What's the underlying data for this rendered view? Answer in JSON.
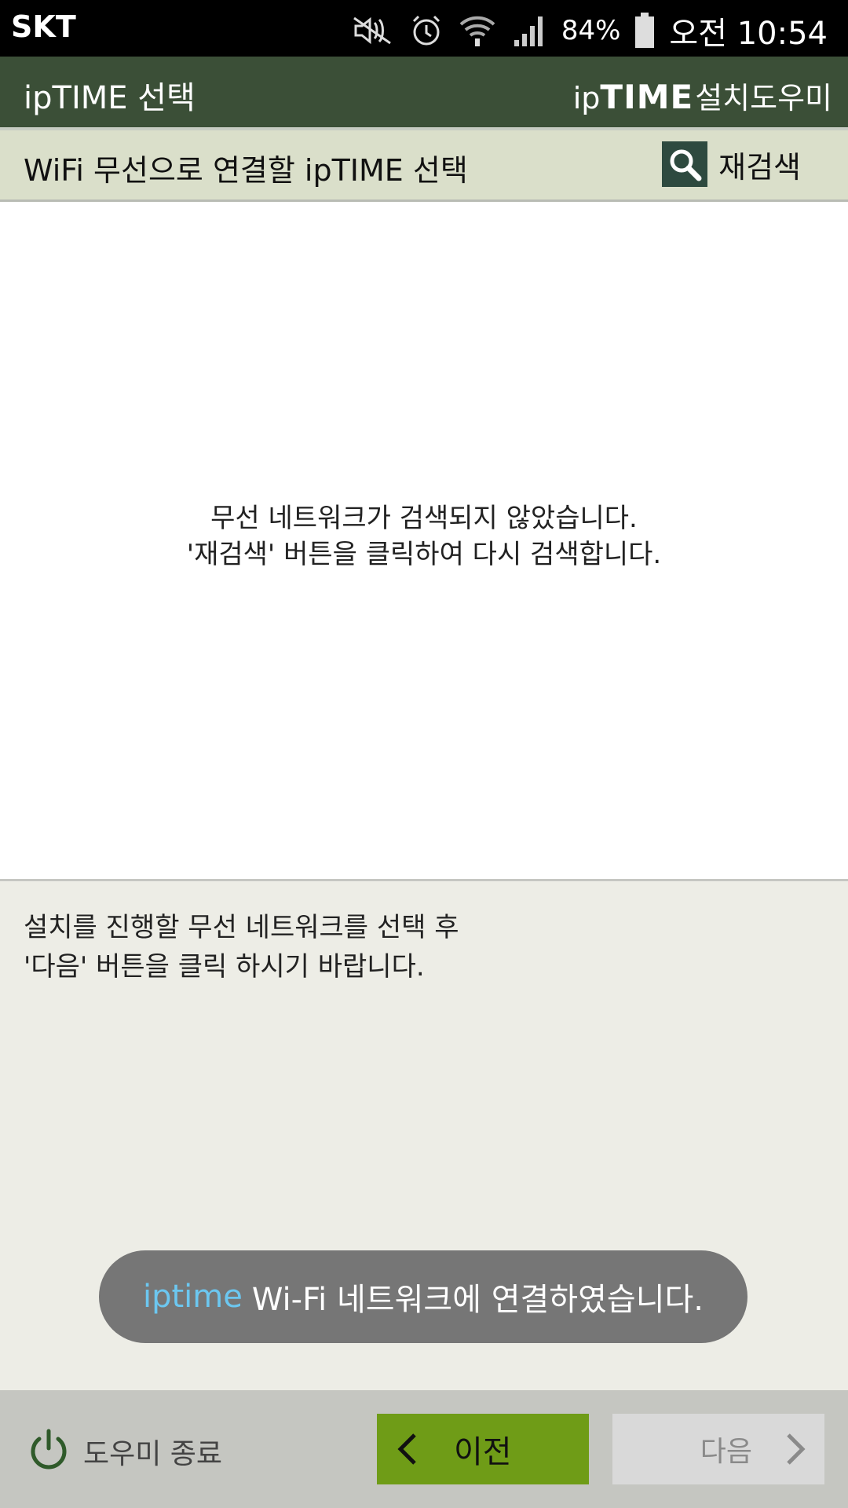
{
  "status_bar": {
    "carrier": "SKT",
    "battery": "84%",
    "time": "오전 10:54",
    "icons": [
      "mute-icon",
      "alarm-icon",
      "wifi-icon",
      "signal-icon",
      "battery-icon"
    ]
  },
  "app_bar": {
    "title": "ipTIME 선택",
    "brand_prefix": "ip",
    "brand_main": "TIME",
    "brand_suffix": "설치도우미"
  },
  "sub_bar": {
    "title": "WiFi 무선으로 연결할 ipTIME 선택",
    "rescan_label": "재검색"
  },
  "list": {
    "empty_line1": "무선 네트워크가 검색되지 않았습니다.",
    "empty_line2": "'재검색' 버튼을 클릭하여 다시 검색합니다."
  },
  "help": {
    "line1": "설치를 진행할 무선 네트워크를 선택 후",
    "line2": "'다음' 버튼을 클릭 하시기 바랍니다."
  },
  "toast": {
    "ssid": "iptime",
    "message": "Wi-Fi 네트워크에 연결하였습니다."
  },
  "bottom_bar": {
    "exit_label": "도우미 종료",
    "prev_label": "이전",
    "next_label": "다음"
  },
  "colors": {
    "app_bar": "#3b4f37",
    "sub_bar": "#dadfca",
    "prev_button": "#6f9c17",
    "next_button_disabled": "#d9d9d9",
    "toast_accent": "#6cc7f0"
  }
}
